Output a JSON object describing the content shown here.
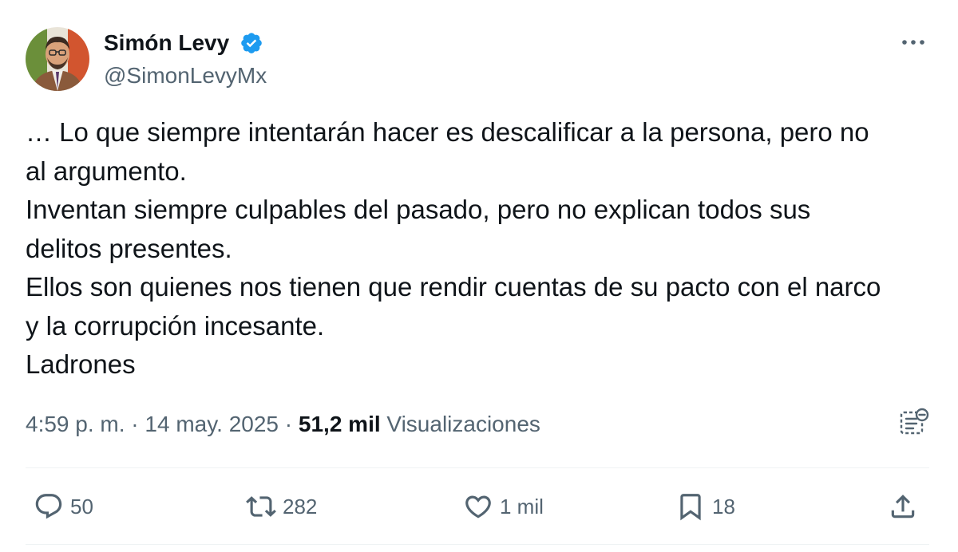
{
  "author": {
    "display_name": "Simón Levy",
    "handle": "@SimonLevyMx",
    "verified": true,
    "verified_color": "#1d9bf0"
  },
  "body_lines": [
    "… Lo que siempre intentarán hacer es descalificar a la persona, pero no",
    "al argumento.",
    "Inventan siempre culpables del pasado, pero no explican todos sus",
    "delitos presentes.",
    "Ellos son quienes nos tienen que rendir cuentas de su pacto con el narco",
    "y la corrupción incesante.",
    "Ladrones"
  ],
  "meta": {
    "time": "4:59 p. m.",
    "separator": "·",
    "date": "14 may. 2025",
    "views_count": "51,2 mil",
    "views_label": "Visualizaciones"
  },
  "actions": {
    "replies": "50",
    "reposts": "282",
    "likes": "1 mil",
    "bookmarks": "18"
  },
  "icons": {
    "more": "more-icon",
    "analytics": "analytics-icon",
    "reply": "reply-icon",
    "repost": "repost-icon",
    "like": "heart-icon",
    "bookmark": "bookmark-icon",
    "share": "share-icon"
  },
  "colors": {
    "text": "#0f1419",
    "secondary": "#536471",
    "divider": "#eff3f4"
  }
}
